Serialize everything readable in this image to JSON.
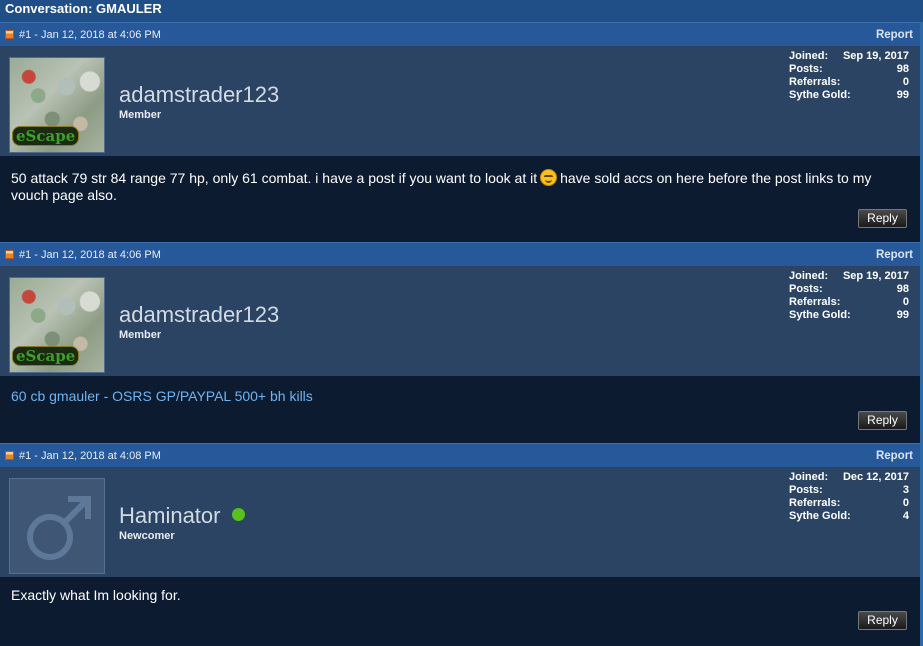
{
  "conversation": {
    "title": "Conversation: GMAULER"
  },
  "posts": [
    {
      "meta": "#1 - Jan 12, 2018 at 4:06 PM",
      "report_label": "Report",
      "username": "adamstrader123",
      "role": "Member",
      "avatar_text": "eScape",
      "avatar_kind": "game-screenshot",
      "online": false,
      "stats": {
        "joined_label": "Joined:",
        "joined_value": "Sep 19, 2017",
        "posts_label": "Posts:",
        "posts_value": "98",
        "referrals_label": "Referrals:",
        "referrals_value": "0",
        "gold_label": "Sythe Gold:",
        "gold_value": "99"
      },
      "message_before": "50 attack 79 str 84 range 77 hp, only 61 combat. i have a post if you want to look at it",
      "message_after": "have sold accs on here before the post links to my vouch page also.",
      "reply_label": "Reply"
    },
    {
      "meta": "#1 - Jan 12, 2018 at 4:06 PM",
      "report_label": "Report",
      "username": "adamstrader123",
      "role": "Member",
      "avatar_text": "eScape",
      "avatar_kind": "game-screenshot",
      "online": false,
      "stats": {
        "joined_label": "Joined:",
        "joined_value": "Sep 19, 2017",
        "posts_label": "Posts:",
        "posts_value": "98",
        "referrals_label": "Referrals:",
        "referrals_value": "0",
        "gold_label": "Sythe Gold:",
        "gold_value": "99"
      },
      "message_link": "60 cb gmauler - OSRS GP/PAYPAL 500+ bh kills",
      "reply_label": "Reply"
    },
    {
      "meta": "#1 - Jan 12, 2018 at 4:08 PM",
      "report_label": "Report",
      "username": "Haminator",
      "role": "Newcomer",
      "avatar_kind": "default-male",
      "online": true,
      "online_color": "#57c21b",
      "stats": {
        "joined_label": "Joined:",
        "joined_value": "Dec 12, 2017",
        "posts_label": "Posts:",
        "posts_value": "3",
        "referrals_label": "Referrals:",
        "referrals_value": "0",
        "gold_label": "Sythe Gold:",
        "gold_value": "4"
      },
      "message": "Exactly what Im looking for.",
      "reply_label": "Reply"
    }
  ],
  "icons": {
    "post": "post-icon",
    "smiley": "smiley-icon",
    "male": "male-symbol-icon",
    "online": "online-status-icon"
  },
  "colors": {
    "header_bg": "#26589a",
    "user_bg": "#2b4463",
    "body_bg": "#0d1b30",
    "link": "#6fb3f0"
  }
}
